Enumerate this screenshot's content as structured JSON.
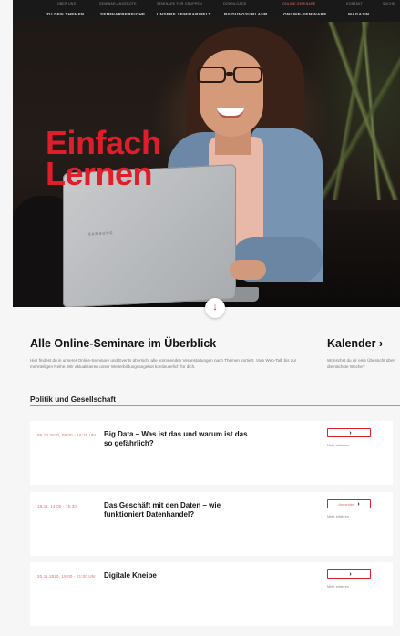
{
  "nav": {
    "utility": [
      "Über uns",
      "Seminar-Angebote",
      "Seminare für Gruppen",
      "Downloads",
      "Online-Seminare",
      "Kontakt",
      "Suche"
    ],
    "main": [
      "Zu den Themen",
      "Seminarbereiche",
      "Unsere Seminarwelt",
      "Bildungsurlaub",
      "Online-Seminare",
      "Magazin"
    ]
  },
  "hero": {
    "title_line1": "Einfach",
    "title_line2": "Lernen",
    "laptop_brand": "SAMSUNG",
    "scroll_icon": "arrow-down-icon",
    "scroll_glyph": "↓"
  },
  "overview": {
    "title": "Alle Online-Seminare im Überblick",
    "description": "Hier findest du in unserer Online-Seminare und Events übersicht alle kommenden Veranstaltungen nach Themen sortiert. Vom Web-Talk bis zur mehrteiligen Reihe. Wir aktualisieren unser Weiterbildungsangebot kontinuierlich für dich."
  },
  "calendar": {
    "title": "Kalender ›",
    "description": "Wünschst du dir eine Übersicht über die nächste Woche?"
  },
  "category": {
    "title": "Politik und Gesellschaft"
  },
  "cards": [
    {
      "date": "05.10.2020, 09:00 - 16:15 Uhr",
      "title": "Big Data – Was ist das und warum ist das so gefährlich?",
      "button_label": "",
      "button_icon": "chevron-right-icon",
      "more": "Mehr erfahren"
    },
    {
      "date": "18.11. 14:00 - 15:30",
      "title": "Das Geschäft mit den Daten – wie funktioniert Datenhandel?",
      "button_label": "Anmelden",
      "button_icon": "chevron-right-icon",
      "more": "Mehr erfahren"
    },
    {
      "date": "20.11.2020, 19:00 - 21:00 Uhr",
      "title": "Digitale Kneipe",
      "button_label": "",
      "button_icon": "chevron-right-icon",
      "more": "Mehr erfahren"
    }
  ],
  "colors": {
    "accent": "#e01e2b",
    "nav_bg": "#191919",
    "page_bg": "#f6f6f6"
  }
}
